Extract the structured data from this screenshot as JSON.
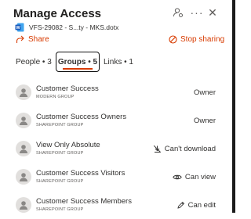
{
  "header": {
    "title": "Manage Access"
  },
  "file": {
    "name": "VFS-29082 - S...ty - MKS.dotx"
  },
  "actions": {
    "share_label": "Share",
    "stop_sharing_label": "Stop sharing"
  },
  "tabs": [
    {
      "label": "People • 3"
    },
    {
      "label": "Groups • 5"
    },
    {
      "label": "Links • 1"
    }
  ],
  "groups": [
    {
      "name": "Customer Success",
      "type": "MODERN GROUP",
      "permission": "Owner",
      "permission_icon": ""
    },
    {
      "name": "Customer Success Owners",
      "type": "SHAREPOINT GROUP",
      "permission": "Owner",
      "permission_icon": ""
    },
    {
      "name": "View Only Absolute",
      "type": "SHAREPOINT GROUP",
      "permission": "Can't download",
      "permission_icon": "no-download-icon"
    },
    {
      "name": "Customer Success Visitors",
      "type": "SHAREPOINT GROUP",
      "permission": "Can view",
      "permission_icon": "eye-icon"
    },
    {
      "name": "Customer Success Members",
      "type": "SHAREPOINT GROUP",
      "permission": "Can edit",
      "permission_icon": "pencil-icon"
    }
  ],
  "colors": {
    "accent": "#d83b01",
    "avatar_bg": "#e1dfdd",
    "word_blue": "#185abd"
  }
}
